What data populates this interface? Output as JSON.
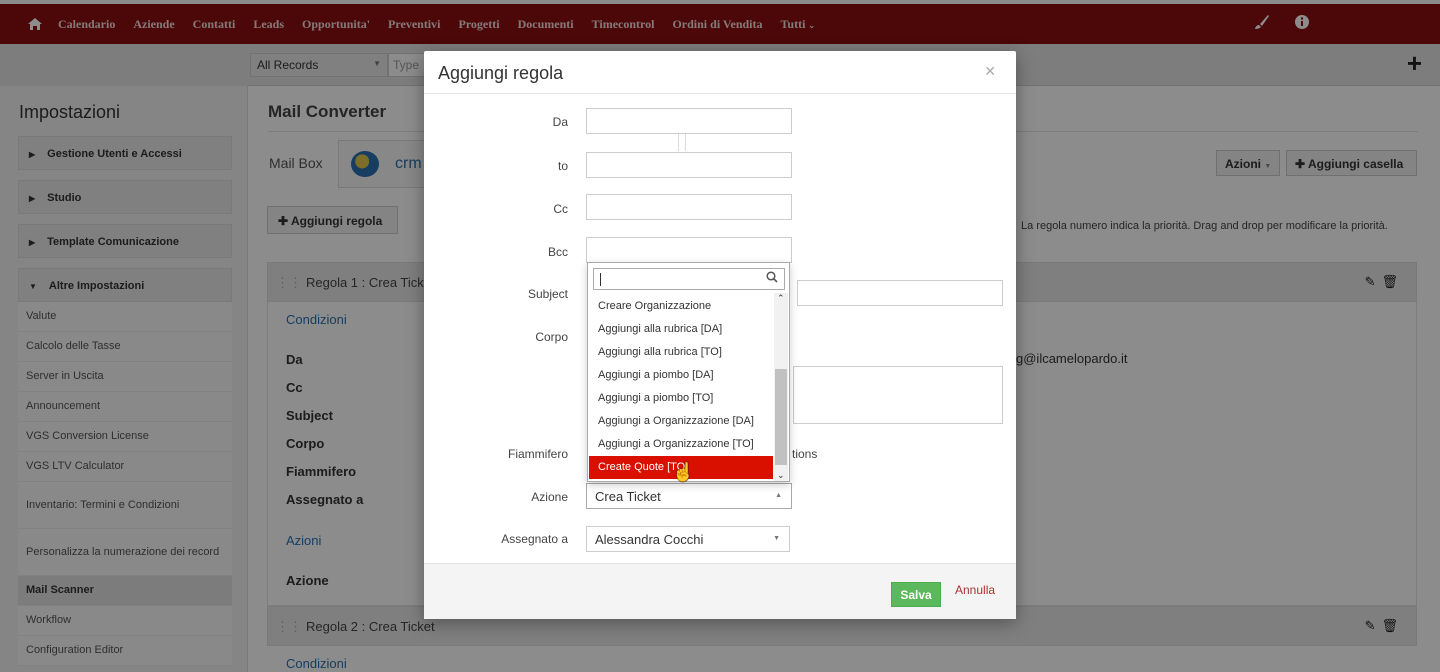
{
  "topnav": {
    "items": [
      "Calendario",
      "Aziende",
      "Contatti",
      "Leads",
      "Opportunita'",
      "Preventivi",
      "Progetti",
      "Documenti",
      "Timecontrol",
      "Ordini di Vendita",
      "Tutti"
    ],
    "bg_color": "#8b0f0f"
  },
  "subbar": {
    "records_select": "All Records",
    "search_placeholder": "Type"
  },
  "sidebar": {
    "title": "Impostazioni",
    "blocks": [
      "Gestione Utenti e Accessi",
      "Studio",
      "Template Comunicazione",
      "Altre Impostazioni"
    ],
    "items": [
      "Valute",
      "Calcolo delle Tasse",
      "Server in Uscita",
      "Announcement",
      "VGS Conversion License",
      "VGS LTV Calculator",
      "Inventario: Termini e Condizioni",
      "Personalizza la numerazione dei record",
      "Mail Scanner",
      "Workflow",
      "Configuration Editor"
    ],
    "active_item": "Mail Scanner"
  },
  "main": {
    "title": "Mail Converter",
    "mailbox_label": "Mail Box",
    "mailbox_name": "crm",
    "azioni_label": "Azioni",
    "add_casella_label": "Aggiungi casella",
    "add_regola_label": "Aggiungi regola",
    "hint": "La regola numero indica la priorità. Drag and drop per modificare la priorità.",
    "rule1_title": "Regola 1 : Crea Ticket",
    "rule2_title": "Regola 2 : Crea Ticket",
    "condizioni_link": "Condizioni",
    "azioni_link": "Azioni",
    "field_labels": [
      "Da",
      "Cc",
      "Subject",
      "Corpo",
      "Fiammifero",
      "Assegnato a"
    ],
    "azione_label": "Azione",
    "email_fragment": "g@ilcamelopardo.it"
  },
  "modal": {
    "title": "Aggiungi regola",
    "labels": {
      "da": "Da",
      "to": "to",
      "cc": "Cc",
      "bcc": "Bcc",
      "subject": "Subject",
      "corpo": "Corpo",
      "fiammifero": "Fiammifero",
      "azione": "Azione",
      "assegnato": "Assegnato a"
    },
    "fiammifero_fragment": "tions",
    "azione_value": "Crea Ticket",
    "assegnato_value": "Alessandra Cocchi",
    "salva_label": "Salva",
    "annulla_label": "Annulla"
  },
  "dropdown": {
    "options": [
      "Creare Organizzazione",
      "Aggiungi alla rubrica [DA]",
      "Aggiungi alla rubrica [TO]",
      "Aggiungi a piombo [DA]",
      "Aggiungi a piombo [TO]",
      "Aggiungi a Organizzazione [DA]",
      "Aggiungi a Organizzazione [TO]",
      "Create Quote [TO]"
    ],
    "highlighted": "Create Quote [TO]",
    "highlight_color": "#d90f00"
  }
}
